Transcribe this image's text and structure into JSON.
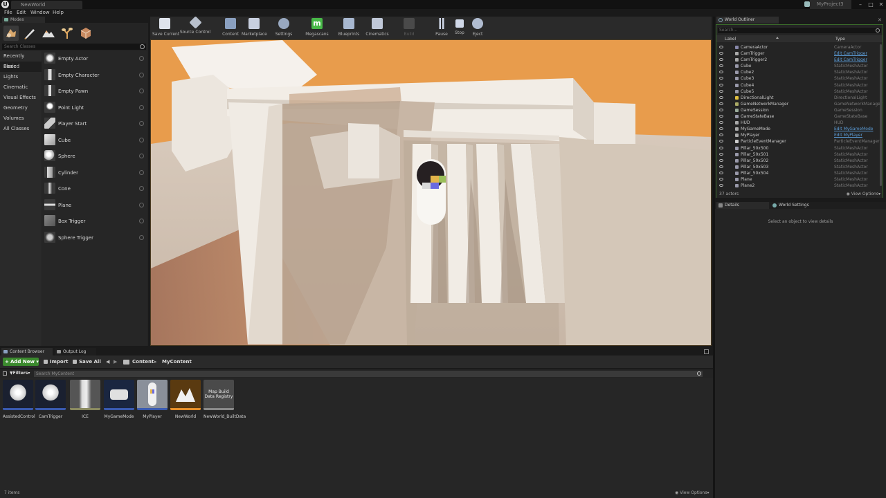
{
  "titlebar": {
    "logo": "U",
    "doc_tab": "NewWorld",
    "project": "MyProject3",
    "controls": {
      "minimize": "–",
      "maximize": "□",
      "close": "✕"
    }
  },
  "menu": [
    "File",
    "Edit",
    "Window",
    "Help"
  ],
  "modes": {
    "tab_label": "Modes",
    "search_placeholder": "Search Classes",
    "categories": [
      "Recently Placed",
      "Basic",
      "Lights",
      "Cinematic",
      "Visual Effects",
      "Geometry",
      "Volumes",
      "All Classes"
    ],
    "active_category": "Basic",
    "items": [
      "Empty Actor",
      "Empty Character",
      "Empty Pawn",
      "Point Light",
      "Player Start",
      "Cube",
      "Sphere",
      "Cylinder",
      "Cone",
      "Plane",
      "Box Trigger",
      "Sphere Trigger"
    ]
  },
  "toolbar": {
    "save_current": "Save Current",
    "source_control": "Source Control",
    "content": "Content",
    "marketplace": "Marketplace",
    "settings": "Settings",
    "megascans": "Megascans",
    "blueprints": "Blueprints",
    "cinematics": "Cinematics",
    "build": "Build",
    "pause": "Pause",
    "stop": "Stop",
    "eject": "Eject"
  },
  "outliner": {
    "tab_label": "World Outliner",
    "close": "✕",
    "search_placeholder": "Search...",
    "col_label": "Label",
    "col_type": "Type",
    "actors": [
      {
        "name": "CameraActor",
        "type": "CameraActor",
        "link": false
      },
      {
        "name": "CamTrigger",
        "type": "Edit CamTrigger",
        "link": true
      },
      {
        "name": "CamTrigger2",
        "type": "Edit CamTrigger",
        "link": true
      },
      {
        "name": "Cube",
        "type": "StaticMeshActor",
        "link": false
      },
      {
        "name": "Cube2",
        "type": "StaticMeshActor",
        "link": false
      },
      {
        "name": "Cube3",
        "type": "StaticMeshActor",
        "link": false
      },
      {
        "name": "Cube4",
        "type": "StaticMeshActor",
        "link": false
      },
      {
        "name": "Cube5",
        "type": "StaticMeshActor",
        "link": false
      },
      {
        "name": "DirectionalLight",
        "type": "DirectionalLight",
        "link": false
      },
      {
        "name": "GameNetworkManager",
        "type": "GameNetworkManager",
        "link": false
      },
      {
        "name": "GameSession",
        "type": "GameSession",
        "link": false
      },
      {
        "name": "GameStateBase",
        "type": "GameStateBase",
        "link": false
      },
      {
        "name": "HUD",
        "type": "HUD",
        "link": false
      },
      {
        "name": "MyGameMode",
        "type": "Edit MyGameMode",
        "link": true
      },
      {
        "name": "MyPlayer",
        "type": "Edit MyPlayer",
        "link": true
      },
      {
        "name": "ParticleEventManager",
        "type": "ParticleEventManager",
        "link": false
      },
      {
        "name": "Pillar_50x500",
        "type": "StaticMeshActor",
        "link": false
      },
      {
        "name": "Pillar_50x501",
        "type": "StaticMeshActor",
        "link": false
      },
      {
        "name": "Pillar_50x502",
        "type": "StaticMeshActor",
        "link": false
      },
      {
        "name": "Pillar_50x503",
        "type": "StaticMeshActor",
        "link": false
      },
      {
        "name": "Pillar_50x504",
        "type": "StaticMeshActor",
        "link": false
      },
      {
        "name": "Plane",
        "type": "StaticMeshActor",
        "link": false
      },
      {
        "name": "Plane2",
        "type": "StaticMeshActor",
        "link": false
      }
    ],
    "count": "37 actors",
    "view_options": "View Options"
  },
  "details": {
    "tab_details": "Details",
    "tab_world_settings": "World Settings",
    "empty_message": "Select an object to view details"
  },
  "content_browser": {
    "tab_content": "Content Browser",
    "tab_output": "Output Log",
    "add_new": "Add New",
    "import": "Import",
    "save_all": "Save All",
    "crumb_root": "Content",
    "crumb_folder": "MyContent",
    "filters": "Filters",
    "search_placeholder": "Search MyContent",
    "assets": [
      {
        "name": "AssistedControl"
      },
      {
        "name": "CamTrigger"
      },
      {
        "name": "ICE"
      },
      {
        "name": "MyGameMode"
      },
      {
        "name": "MyPlayer"
      },
      {
        "name": "NewWorld"
      },
      {
        "name": "NewWorld_BuiltData",
        "thumb_text": "Map Build Data Registry"
      }
    ],
    "item_count": "7 items",
    "view_options": "View Options"
  },
  "colors": {
    "sky": "#e89c4c",
    "wall": "#f2ede6",
    "add_new_green": "#3b8a2e",
    "link_blue": "#5b9bd5"
  }
}
